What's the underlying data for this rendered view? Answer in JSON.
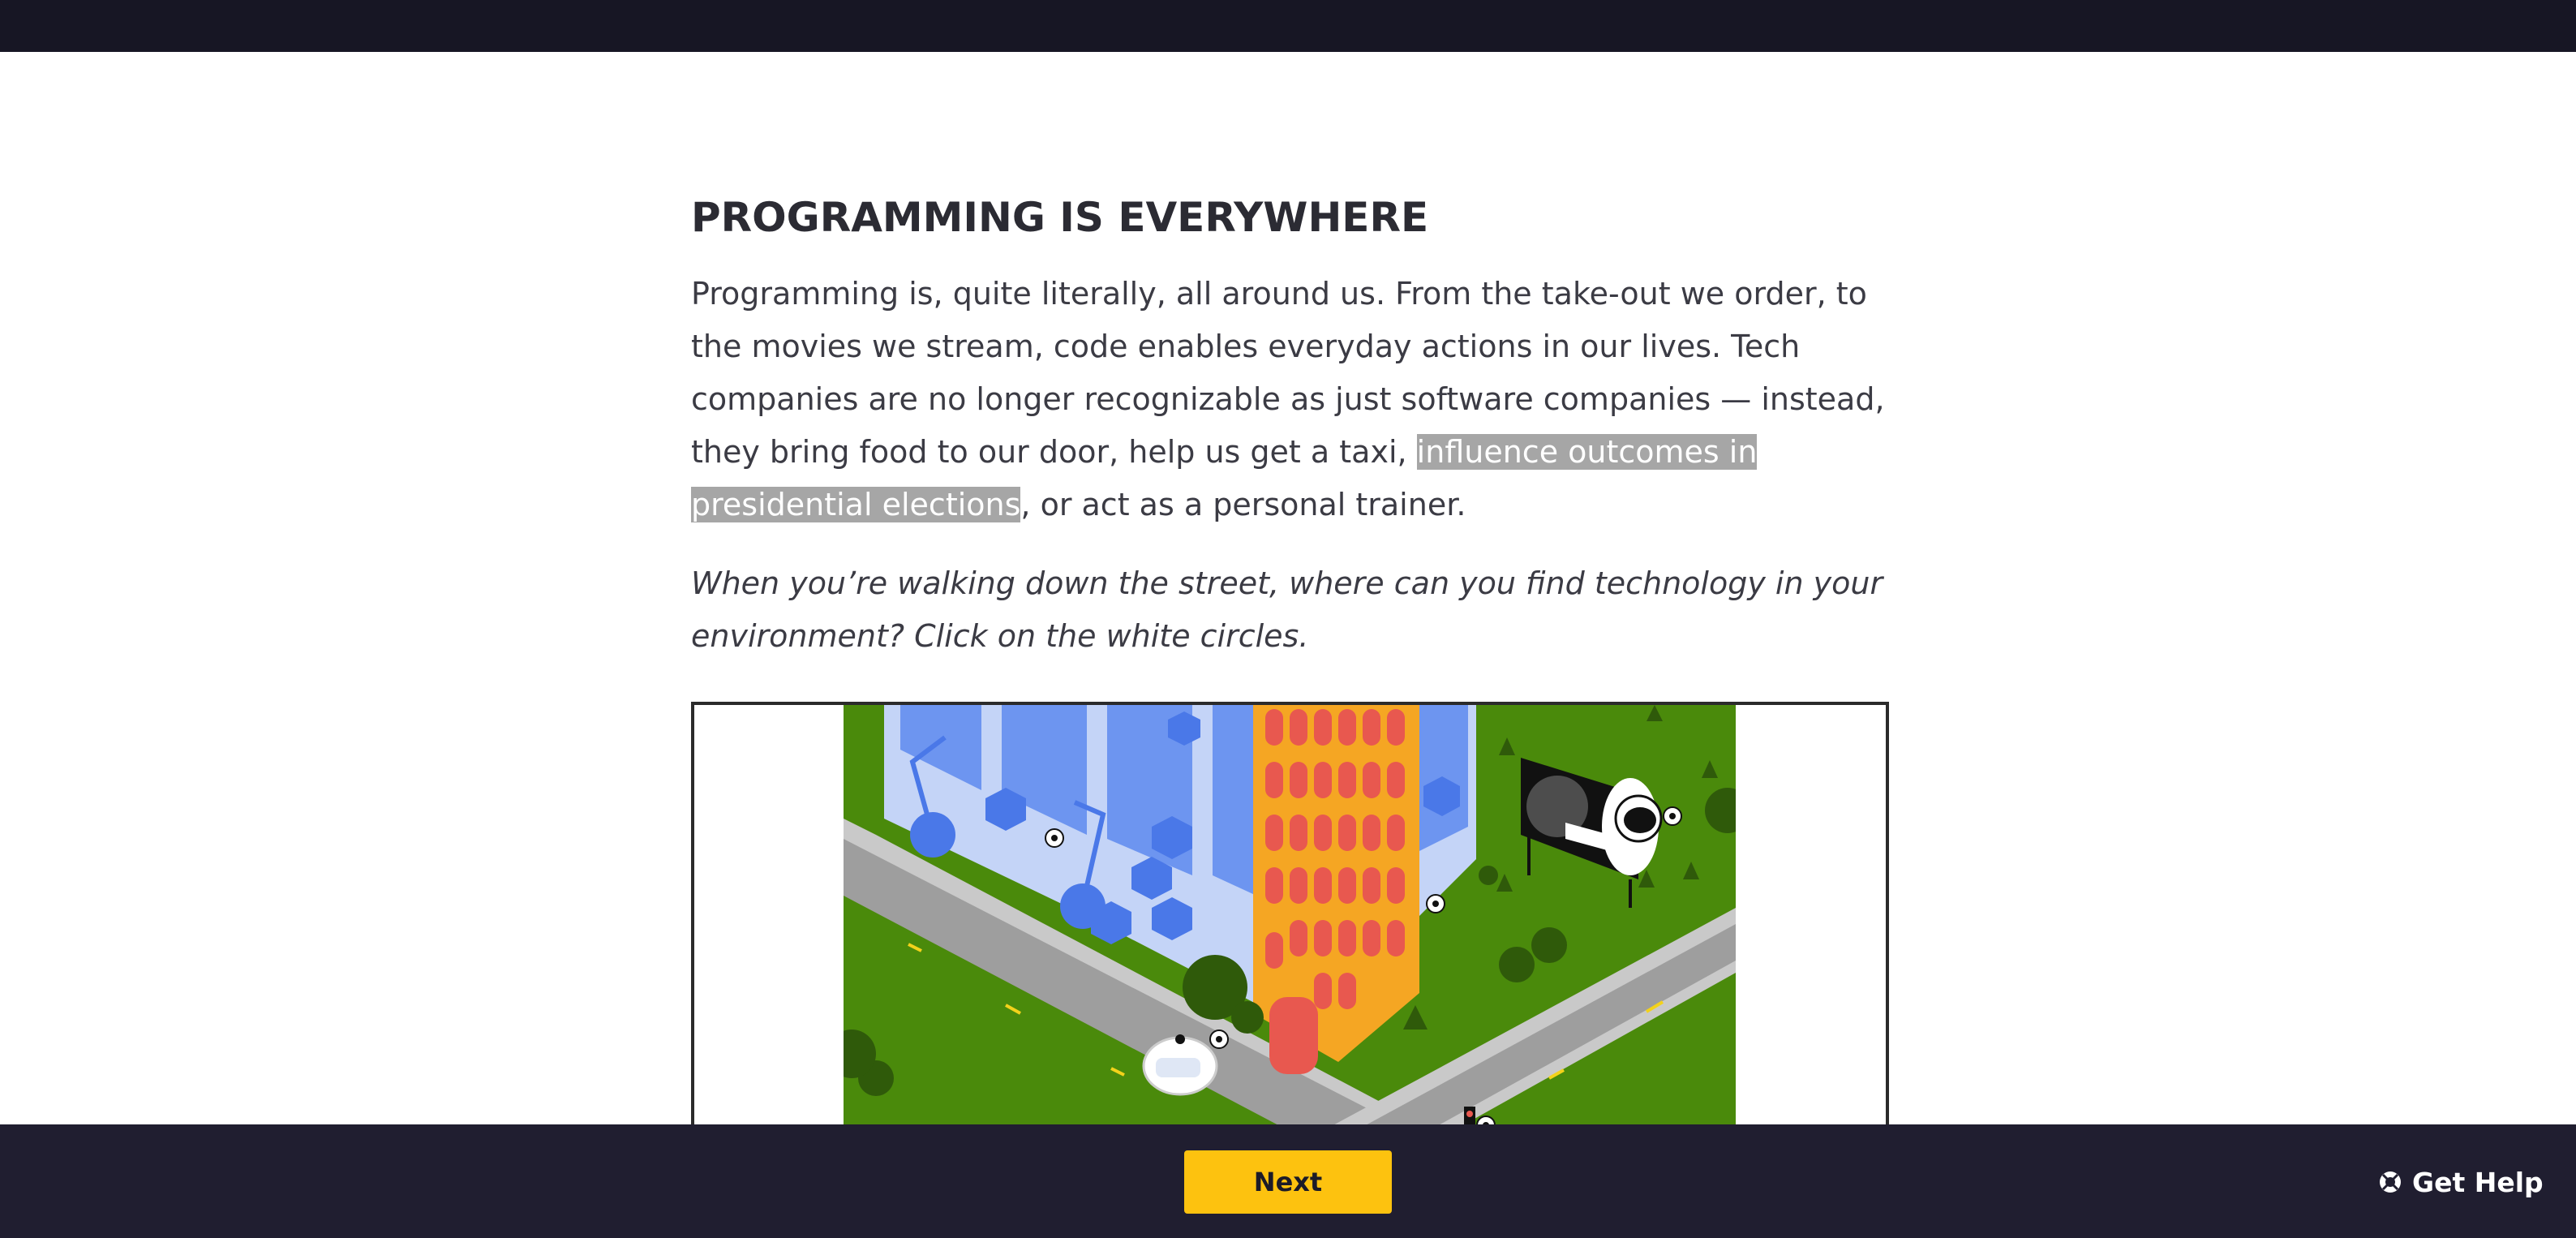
{
  "lesson": {
    "title": "PROGRAMMING IS EVERYWHERE",
    "paragraph_before": "Programming is, quite literally, all around us. From the take-out we order, to the movies we stream, code enables everyday actions in our lives. Tech companies are no longer recognizable as just software companies — instead, they bring food to our door, help us get a taxi, ",
    "paragraph_link": "influence outcomes in presidential elections",
    "paragraph_after": ", or act as a personal trainer.",
    "prompt": "When you’re walking down the street, where can you find technology in your environment? Click on the white circles."
  },
  "footer": {
    "next_label": "Next",
    "help_label": "Get Help",
    "help_icon": "lifebuoy-icon"
  },
  "colors": {
    "top_bar": "#171624",
    "bottom_bar": "#201e30",
    "next_button": "#fdc20f",
    "highlight": "#a6a6a6",
    "grass": "#4a8a0b",
    "road": "#9e9e9e",
    "building_blue": "#6d95f0",
    "building_orange": "#f5a623"
  }
}
